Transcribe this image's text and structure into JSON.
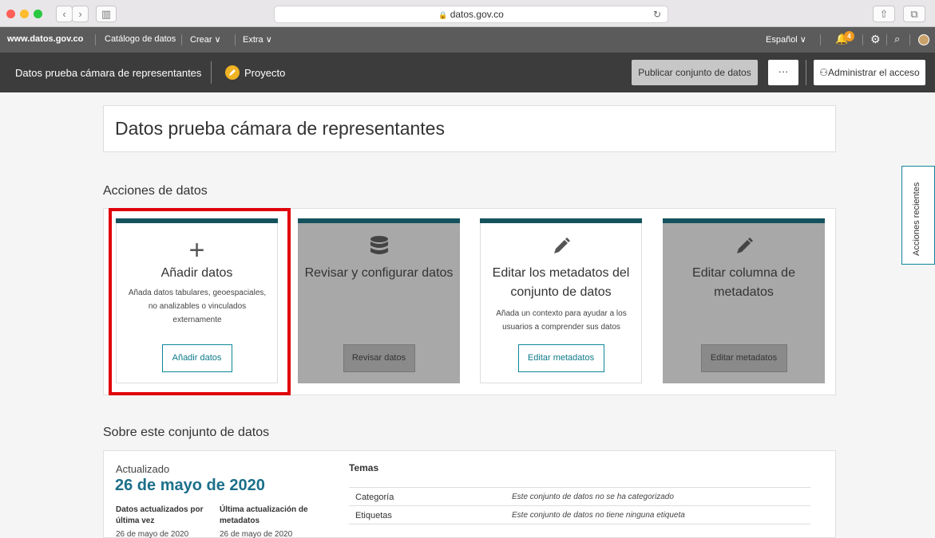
{
  "browser": {
    "url": "datos.gov.co",
    "nav_back": "‹",
    "nav_forward": "›",
    "sidebar_btn": "▥",
    "reload": "↻",
    "share": "⇧",
    "tabs_btn": "⧉"
  },
  "topnav": {
    "site": "www.datos.gov.co",
    "catalog": "Catálogo de datos",
    "create": "Crear ∨",
    "extra": "Extra ∨",
    "language": "Español ∨",
    "notif_count": "4"
  },
  "dataset_bar": {
    "title": "Datos prueba cámara de representantes",
    "project": "Proyecto",
    "publish": "Publicar conjunto de datos",
    "more": "···",
    "access": "Administrar el acceso"
  },
  "page": {
    "title": "Datos prueba cámara de representantes",
    "actions_title": "Acciones de datos",
    "about_title": "Sobre este conjunto de datos",
    "recent_actions": "Acciones recientes"
  },
  "cards": [
    {
      "title": "Añadir datos",
      "desc": "Añada datos tabulares, geoespaciales, no analizables o vinculados externamente",
      "button": "Añadir datos",
      "icon": "plus-icon"
    },
    {
      "title": "Revisar y configurar datos",
      "desc": "",
      "button": "Revisar datos",
      "icon": "database-icon"
    },
    {
      "title": "Editar los metadatos del conjunto de datos",
      "desc": "Añada un contexto para ayudar a los usuarios a comprender sus datos",
      "button": "Editar metadatos",
      "icon": "pencil-icon"
    },
    {
      "title": "Editar columna de metadatos",
      "desc": "",
      "button": "Editar metadatos",
      "icon": "pencil-icon"
    }
  ],
  "about": {
    "updated_label": "Actualizado",
    "updated_date": "26 de mayo de 2020",
    "data_updated_label": "Datos actualizados por última vez",
    "data_updated_date": "26 de mayo de 2020",
    "meta_updated_label": "Última actualización de metadatos",
    "meta_updated_date": "26 de mayo de 2020",
    "topics_title": "Temas",
    "rows": [
      {
        "key": "Categoría",
        "value": "Este conjunto de datos no se ha categorizado"
      },
      {
        "key": "Etiquetas",
        "value": "Este conjunto de datos no tiene ninguna etiqueta"
      }
    ]
  }
}
